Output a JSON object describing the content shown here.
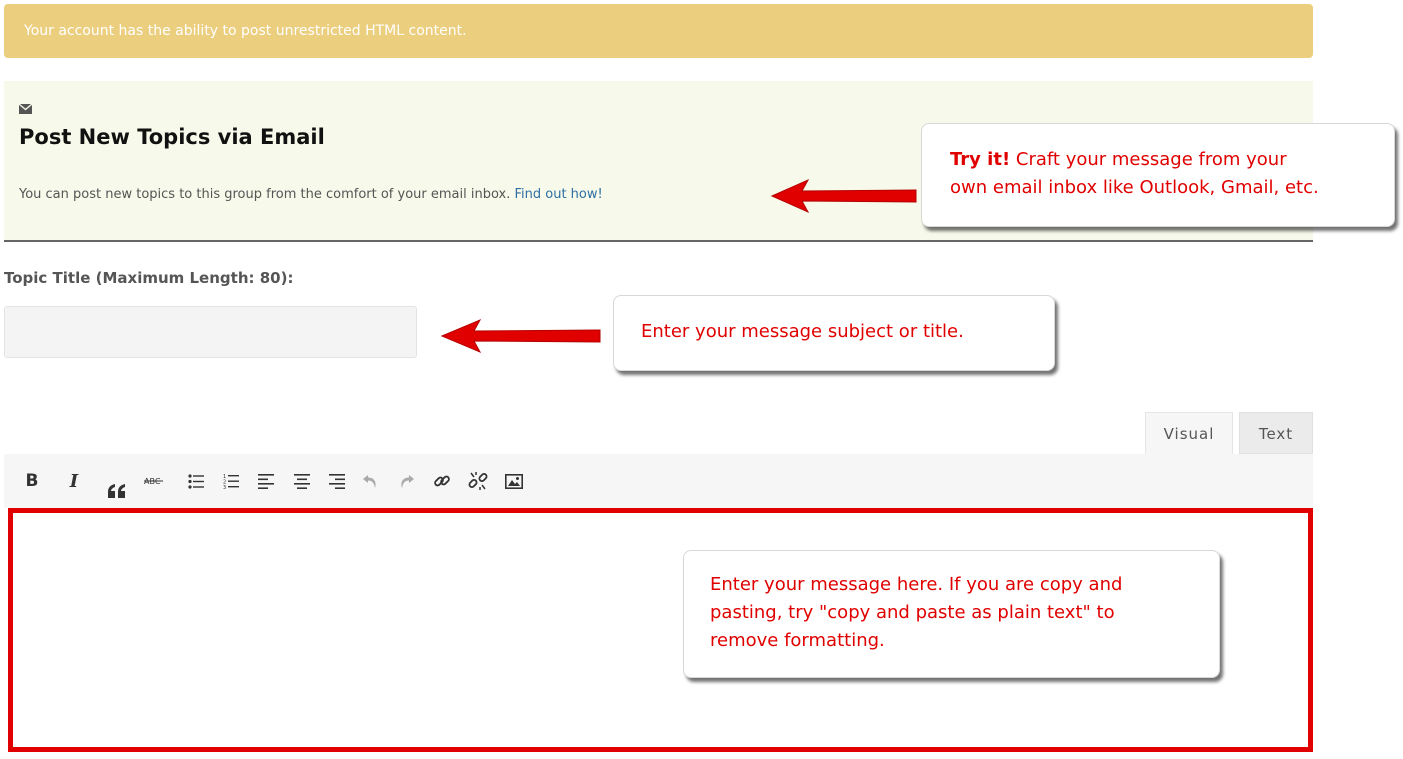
{
  "notice": {
    "text": "Your account has the ability to post unrestricted HTML content.",
    "color": "#ecce7f"
  },
  "email_panel": {
    "icon": "envelope-icon",
    "title": "Post New Topics via Email",
    "description": "You can post new topics to this group from the comfort of your email inbox.",
    "link_label": "Find out how!"
  },
  "topic": {
    "label": "Topic Title (Maximum Length: 80):",
    "value": "",
    "placeholder": ""
  },
  "editor": {
    "tabs": [
      {
        "label": "Visual",
        "active": true
      },
      {
        "label": "Text",
        "active": false
      }
    ],
    "toolbar": [
      {
        "name": "bold",
        "icon": "bold-icon",
        "glyph": "B"
      },
      {
        "name": "italic",
        "icon": "italic-icon",
        "glyph": "I"
      },
      {
        "name": "blockquote",
        "icon": "blockquote-icon",
        "glyph": "“"
      },
      {
        "name": "strikethrough",
        "icon": "strikethrough-icon"
      },
      {
        "name": "bullet-list",
        "icon": "bullet-list-icon"
      },
      {
        "name": "numbered-list",
        "icon": "numbered-list-icon"
      },
      {
        "name": "align-left",
        "icon": "align-left-icon"
      },
      {
        "name": "align-center",
        "icon": "align-center-icon"
      },
      {
        "name": "align-right",
        "icon": "align-right-icon"
      },
      {
        "name": "undo",
        "icon": "undo-icon"
      },
      {
        "name": "redo",
        "icon": "redo-icon"
      },
      {
        "name": "insert-link",
        "icon": "link-icon"
      },
      {
        "name": "remove-link",
        "icon": "unlink-icon"
      },
      {
        "name": "insert-image",
        "icon": "image-icon"
      }
    ],
    "content": "",
    "highlight_color": "#e00000"
  },
  "callouts": {
    "email": {
      "bold": "Try it!",
      "line1": " Craft your message from your",
      "line2": "own email inbox like Outlook, Gmail, etc."
    },
    "subject": {
      "text": "Enter your message subject or title."
    },
    "message": {
      "line1": "Enter your message here. If you are copy and",
      "line2": "pasting, try \"copy and paste as plain text\" to",
      "line3": "remove formatting."
    },
    "text_color": "#e00000"
  }
}
